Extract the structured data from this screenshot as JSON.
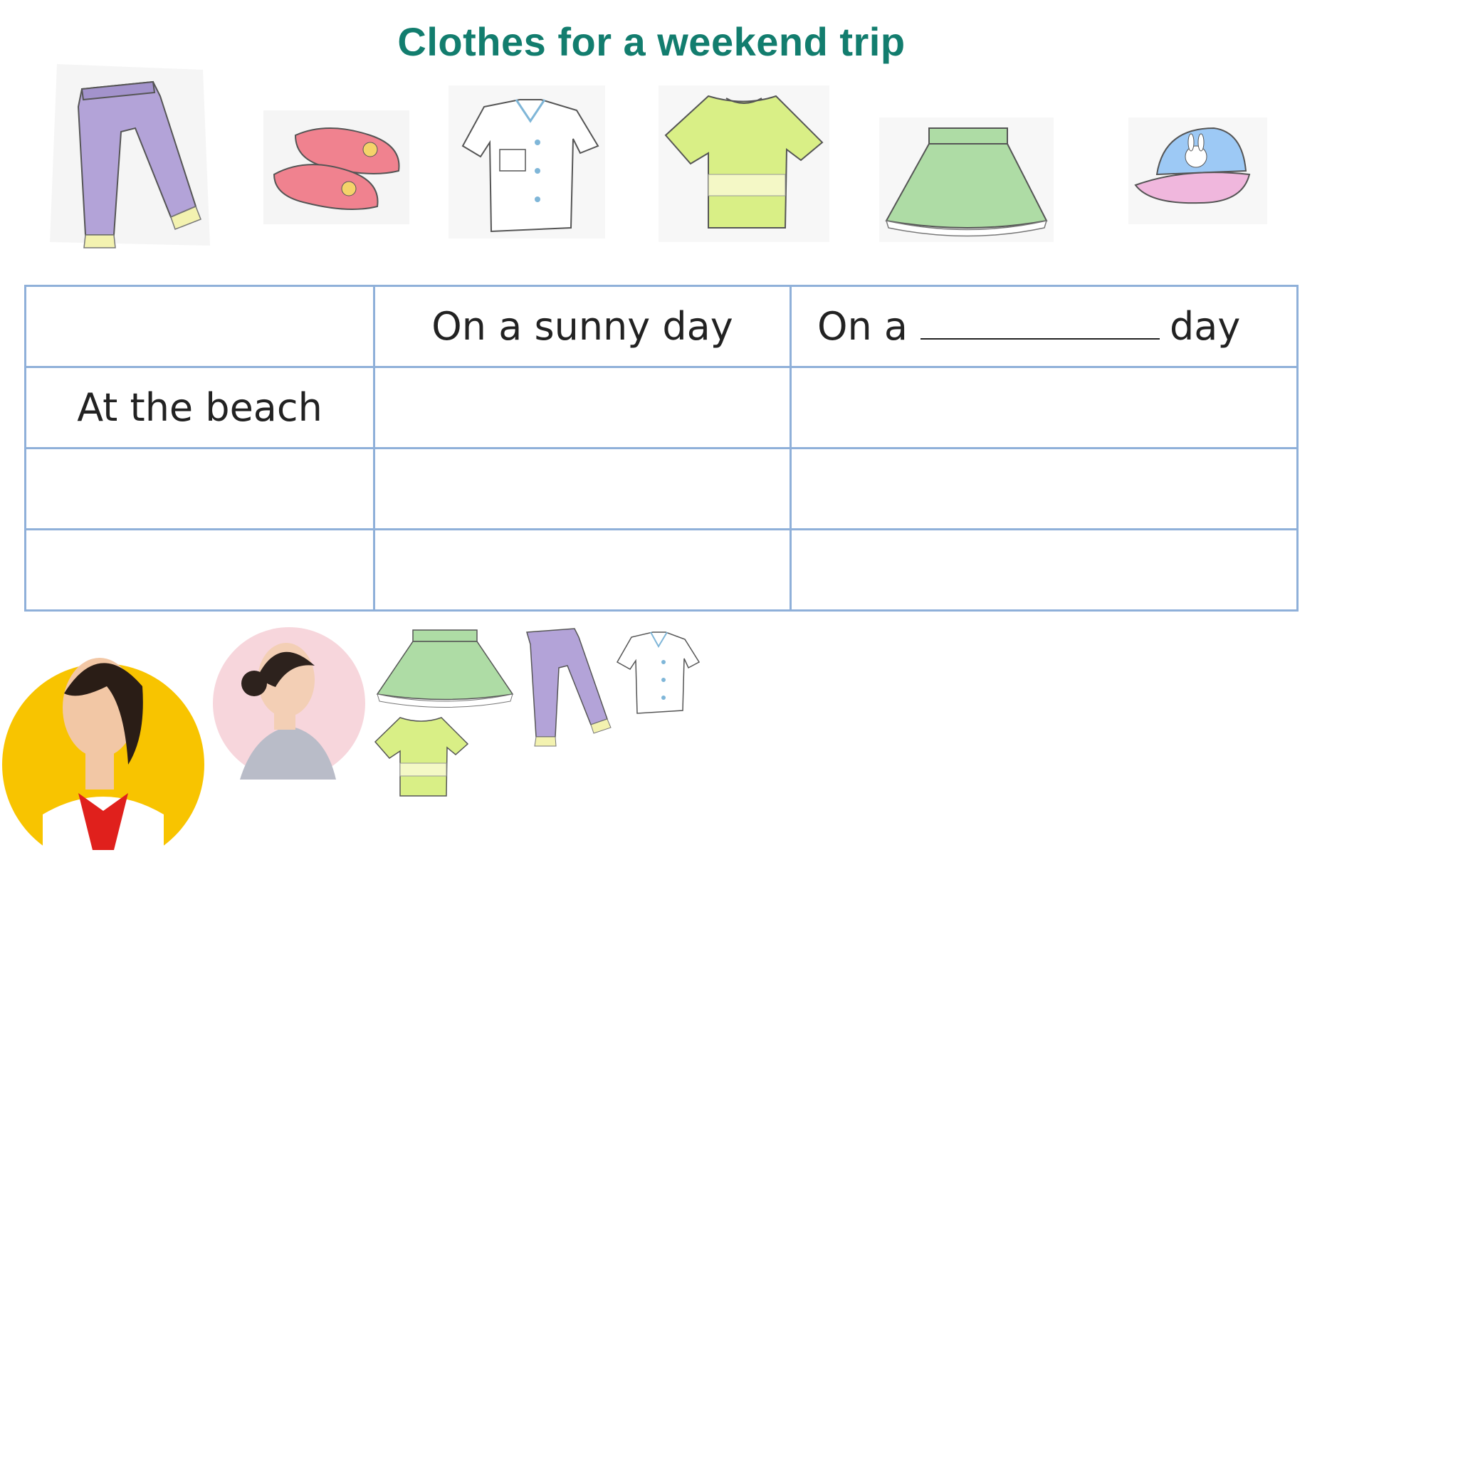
{
  "page": {
    "title": "Clothes for a weekend trip"
  },
  "colors": {
    "title": "#127d6e",
    "table_border": "#8fb0d9",
    "text": "#222222",
    "purple_pants": "#b3a3d8",
    "pink_shoes": "#f0828f",
    "light_green_tshirt": "#d9ef86",
    "green_skirt": "#aedca5",
    "blue_cap": "#9dc9f5",
    "yellow_circle": "#f8c400",
    "pink_circle": "#f7d6dc"
  },
  "clothing_items": [
    {
      "name": "trousers",
      "icon": "purple-trousers-icon"
    },
    {
      "name": "shoes",
      "icon": "pink-shoes-icon"
    },
    {
      "name": "shirt",
      "icon": "white-shirt-icon"
    },
    {
      "name": "t-shirt",
      "icon": "green-tshirt-icon"
    },
    {
      "name": "skirt",
      "icon": "green-skirt-icon"
    },
    {
      "name": "cap",
      "icon": "bunny-cap-icon"
    }
  ],
  "table": {
    "header": {
      "corner": "",
      "col1": "On a sunny day",
      "col2_prefix": "On a",
      "col2_suffix": "day"
    },
    "rows": [
      {
        "label": "At the beach",
        "c1": "",
        "c2": ""
      },
      {
        "label": "",
        "c1": "",
        "c2": ""
      },
      {
        "label": "",
        "c1": "",
        "c2": ""
      }
    ]
  },
  "bottom": {
    "people": [
      "girl-student-photo",
      "woman-photo"
    ],
    "small_clothes": [
      "green-skirt-icon",
      "purple-trousers-icon",
      "white-shirt-icon",
      "green-tshirt-icon"
    ]
  }
}
